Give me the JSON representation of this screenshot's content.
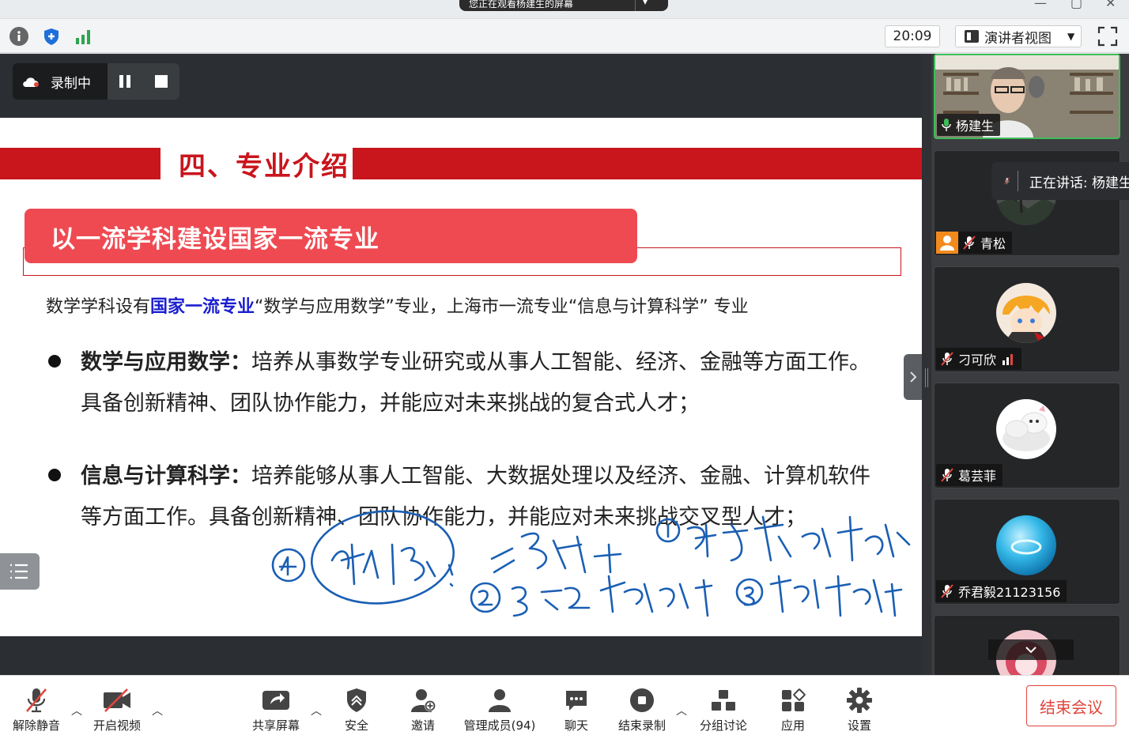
{
  "share_banner": {
    "text": "您正在观看杨建生的屏幕"
  },
  "topbar": {
    "clock": "20:09",
    "presenter_view": "演讲者视图"
  },
  "recording": {
    "label": "录制中"
  },
  "slide": {
    "section_title": "四、专业介绍",
    "banner": "以一流学科建设国家一流专业",
    "intro_prefix": "数学学科设有",
    "intro_highlight": "国家一流专业",
    "intro_suffix": "“数学与应用数学”专业，上海市一流专业“信息与计算科学” 专业",
    "bullets": [
      {
        "title": "数学与应用数学：",
        "text": "培养从事数学专业研究或从事人工智能、经济、金融等方面工作。具备创新精神、团队协作能力，并能应对未来挑战的复合式人才；"
      },
      {
        "title": "信息与计算科学：",
        "text": "培养能够从事人工智能、大数据处理以及经济、金融、计算机软件等方面工作。具备创新精神、团队协作能力，并能应对未来挑战交叉型人才；"
      }
    ]
  },
  "participants": {
    "speaking": "正在讲话: 杨建生",
    "list": [
      {
        "name": "杨建生"
      },
      {
        "name": "青松"
      },
      {
        "name": "刁可欣"
      },
      {
        "name": "葛芸菲"
      },
      {
        "name": "乔君毅21123156"
      }
    ]
  },
  "bottombar": {
    "unmute": "解除静音",
    "start_video": "开启视频",
    "share_screen": "共享屏幕",
    "security": "安全",
    "invite": "邀请",
    "manage_members": "管理成员(94)",
    "chat": "聊天",
    "end_recording": "结束录制",
    "breakout": "分组讨论",
    "apps": "应用",
    "settings": "设置",
    "end_meeting": "结束会议"
  },
  "colors": {
    "slide_red": "#c9151c",
    "banner_red": "#ef4a52",
    "highlight_blue": "#1a1ecf",
    "active_green": "#3dbd58",
    "end_red": "#e0463e",
    "ink_blue": "#1a5fb4"
  }
}
